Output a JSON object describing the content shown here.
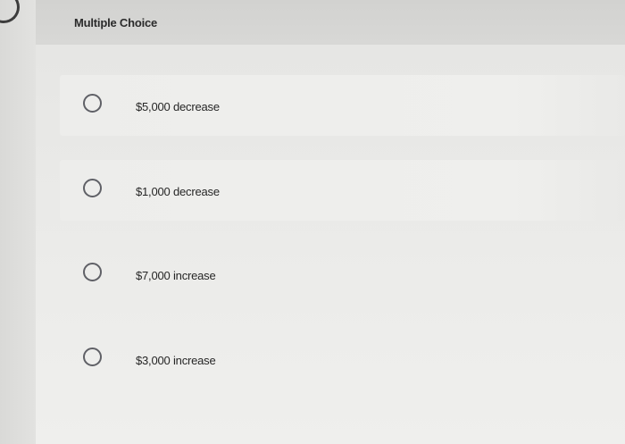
{
  "question": {
    "type_label": "Multiple Choice"
  },
  "options": [
    {
      "label": "$5,000 decrease",
      "selected": false
    },
    {
      "label": "$1,000 decrease",
      "selected": false
    },
    {
      "label": "$7,000 increase",
      "selected": false
    },
    {
      "label": "$3,000 increase",
      "selected": false
    }
  ],
  "colors": {
    "radio_border": "#5f6066",
    "text": "#262626",
    "header_bg": "#d4d4d2",
    "page_bg": "#e8e8e6"
  }
}
